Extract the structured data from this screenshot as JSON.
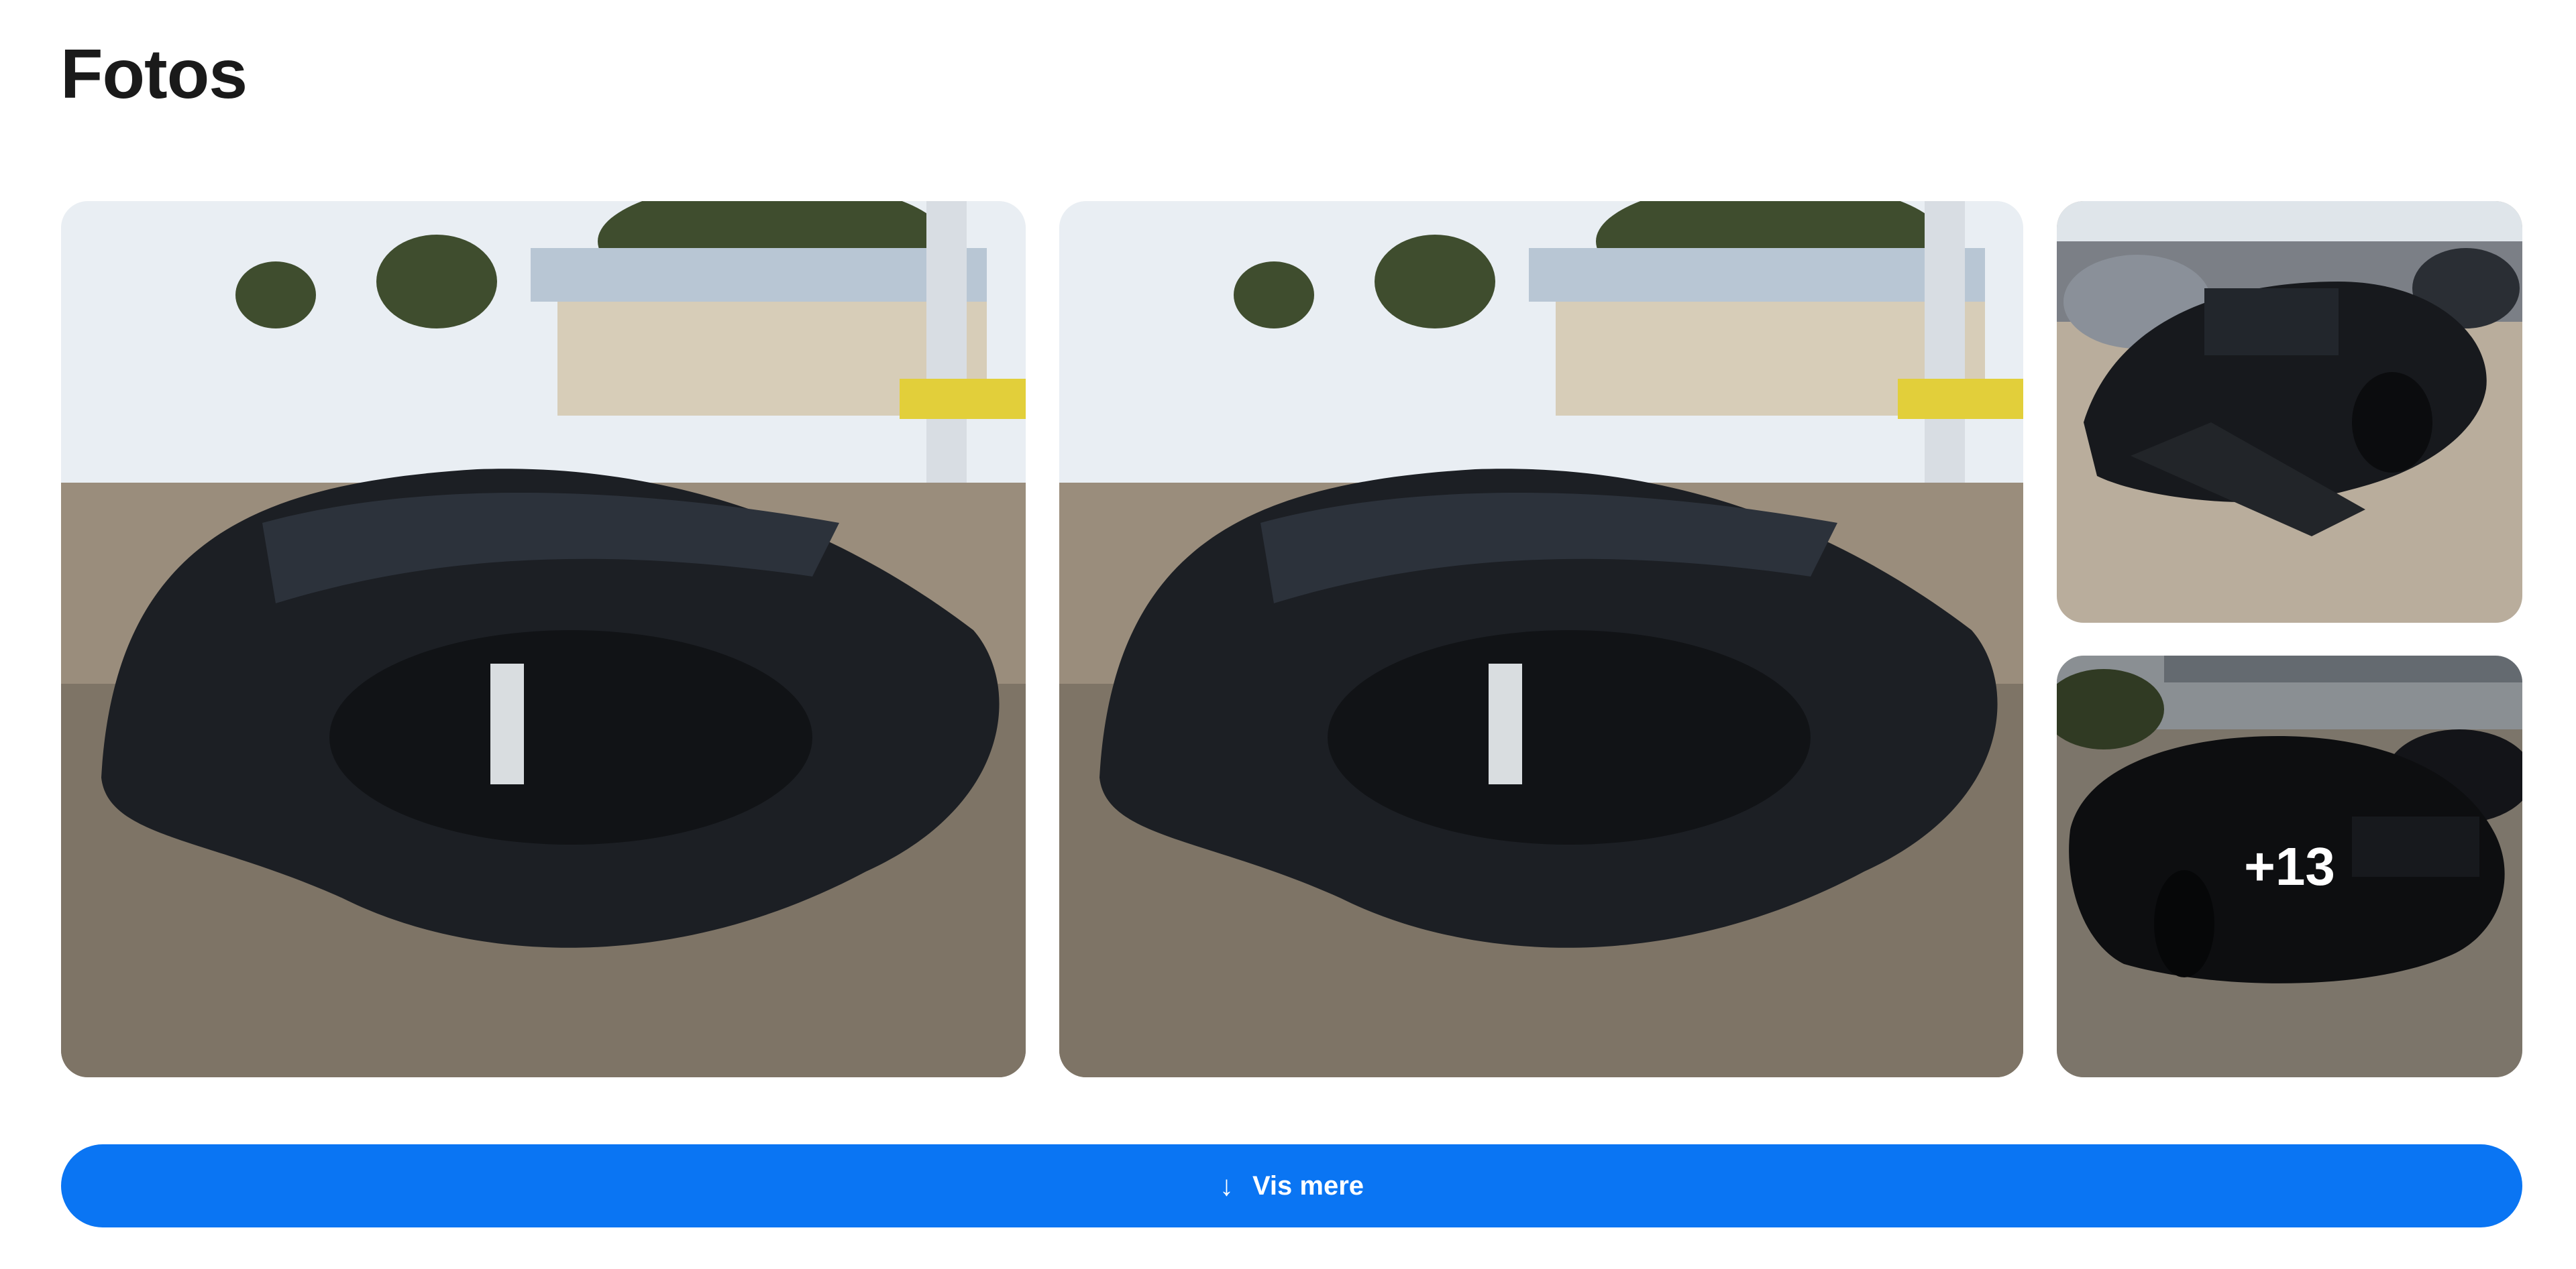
{
  "section": {
    "title": "Fotos"
  },
  "gallery": {
    "photos": [
      {
        "alt": "damaged black car front"
      },
      {
        "alt": "damaged black car front"
      },
      {
        "alt": "damaged black car front"
      },
      {
        "alt": "black car rear"
      }
    ],
    "more_count_label": "+13"
  },
  "actions": {
    "show_more_icon": "arrow-down-icon",
    "show_more_label": "Vis mere"
  },
  "colors": {
    "accent": "#0a75f3",
    "title": "#1a1a1a"
  }
}
